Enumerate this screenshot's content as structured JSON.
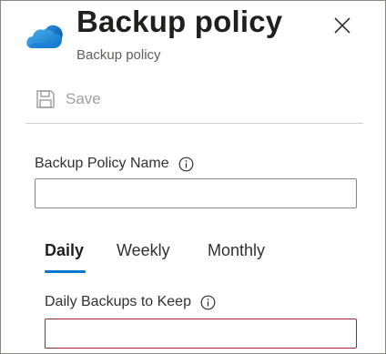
{
  "header": {
    "title": "Backup policy",
    "subtitle": "Backup policy",
    "logo_icon": "azure-cloud-icon",
    "close_icon": "close-icon"
  },
  "toolbar": {
    "save_label": "Save",
    "save_icon": "save-icon",
    "save_enabled": false
  },
  "form": {
    "policy_name_label": "Backup Policy Name",
    "policy_name_value": "",
    "daily_backups_label": "Daily Backups to Keep",
    "daily_backups_value": ""
  },
  "tabs": [
    {
      "label": "Daily",
      "active": true
    },
    {
      "label": "Weekly",
      "active": false
    },
    {
      "label": "Monthly",
      "active": false
    }
  ],
  "colors": {
    "accent": "#0078d4",
    "error_border": "#a4262c",
    "disabled_text": "#a19f9d"
  }
}
